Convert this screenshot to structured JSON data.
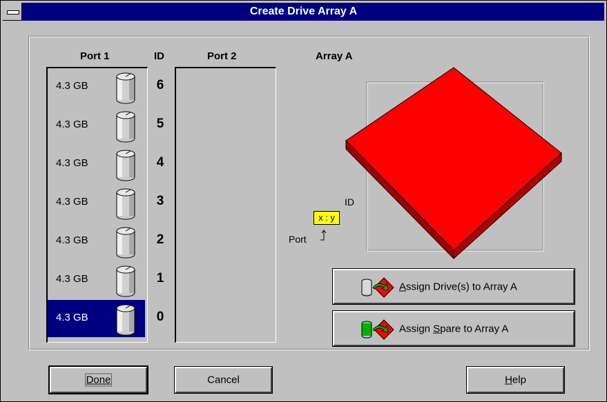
{
  "window": {
    "title": "Create Drive Array A"
  },
  "headers": {
    "port1": "Port 1",
    "id": "ID",
    "port2": "Port 2",
    "array": "Array A"
  },
  "port1_drives": [
    {
      "size": "4.3 GB",
      "id": "6",
      "selected": false
    },
    {
      "size": "4.3 GB",
      "id": "5",
      "selected": false
    },
    {
      "size": "4.3 GB",
      "id": "4",
      "selected": false
    },
    {
      "size": "4.3 GB",
      "id": "3",
      "selected": false
    },
    {
      "size": "4.3 GB",
      "id": "2",
      "selected": false
    },
    {
      "size": "4.3 GB",
      "id": "1",
      "selected": false
    },
    {
      "size": "4.3 GB",
      "id": "0",
      "selected": true
    }
  ],
  "port2_drives": [],
  "legend": {
    "box": "x : y",
    "id_label": "ID",
    "port_label": "Port"
  },
  "buttons": {
    "assign_drives_pre": "A",
    "assign_drives_post": "ssign Drive(s) to Array A",
    "assign_spare_pre": "Assign ",
    "assign_spare_ul": "S",
    "assign_spare_post": "pare to Array A",
    "done": "Done",
    "cancel": "Cancel",
    "help_ul": "H",
    "help_post": "elp"
  },
  "colors": {
    "titlebar": "#000080",
    "selection": "#000080",
    "array_face": "#ff0000",
    "legend_box": "#ffff00",
    "spare_icon": "#00b000"
  },
  "icons": {
    "drive": "cylinder-drive-icon",
    "assign_arrow": "red-diamond-arrow-icon"
  }
}
